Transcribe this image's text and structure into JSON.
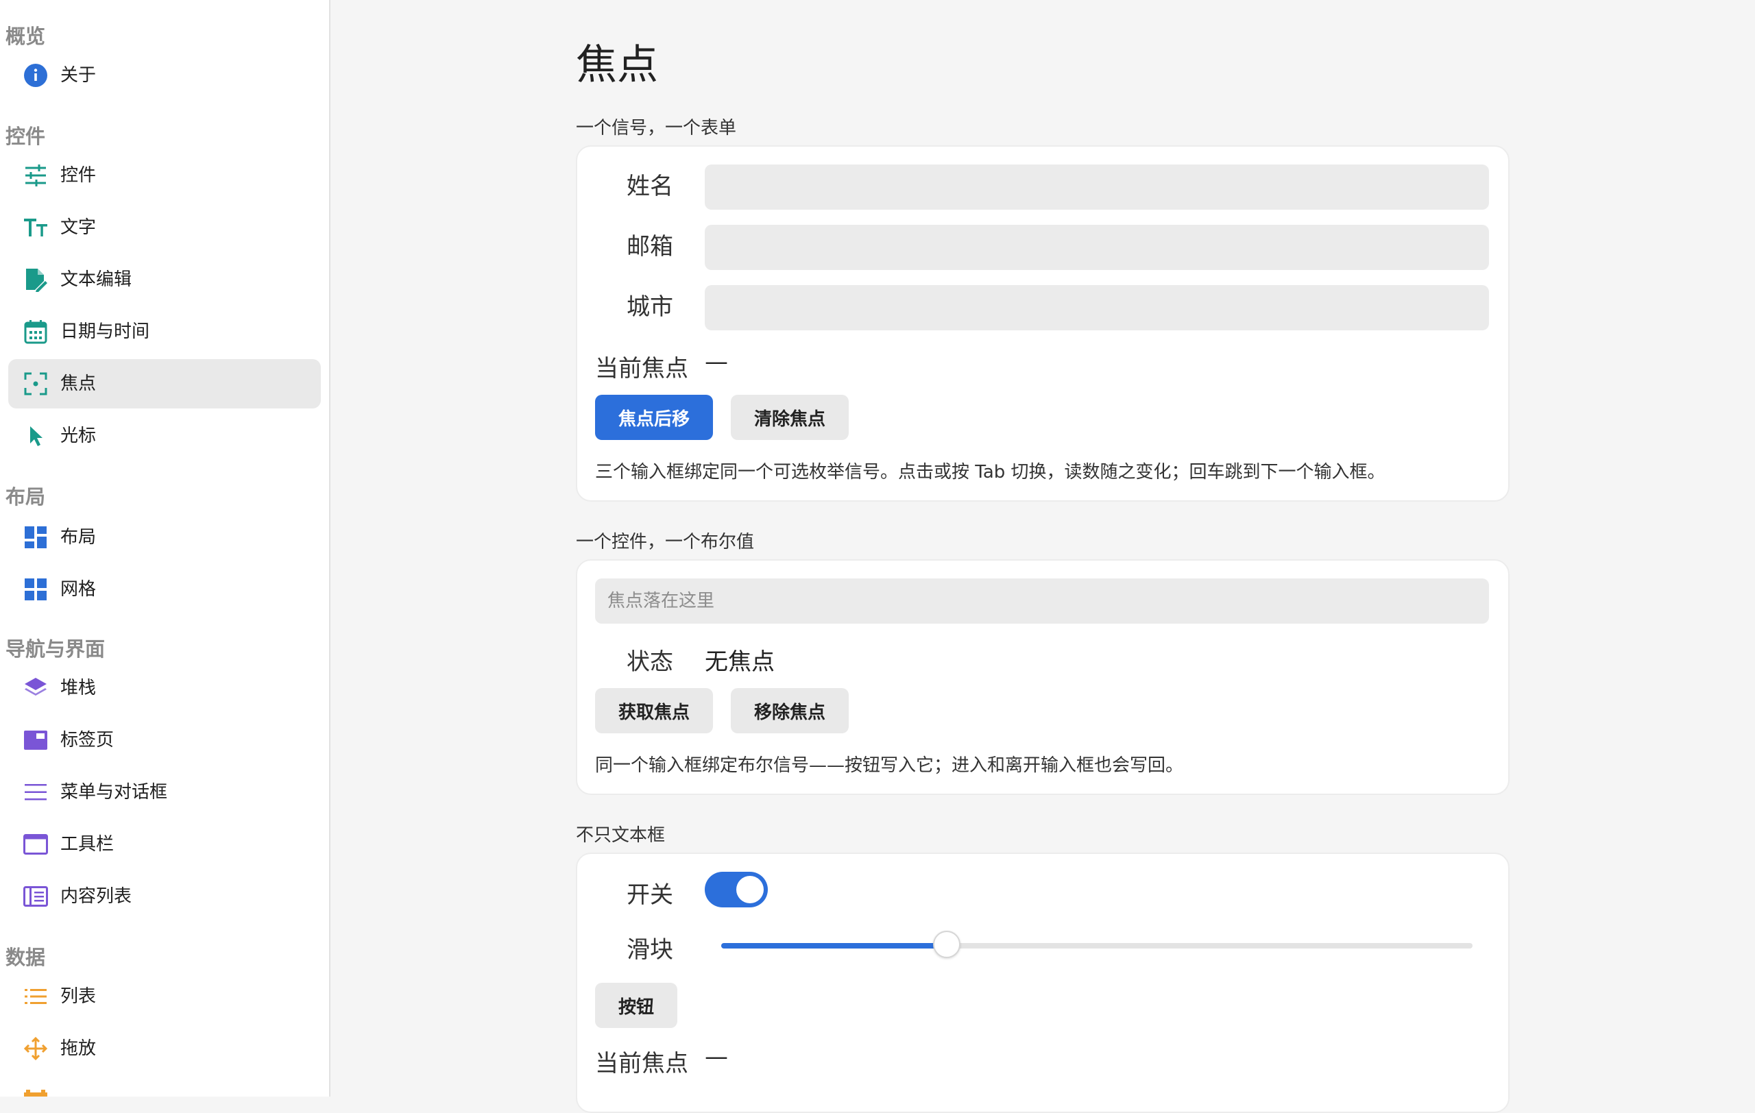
{
  "sidebar": {
    "sections": [
      {
        "title": "概览"
      },
      {
        "title": "控件"
      },
      {
        "title": "布局"
      },
      {
        "title": "导航与界面"
      },
      {
        "title": "数据"
      }
    ],
    "items": [
      {
        "label": "关于",
        "icon": "info-icon"
      },
      {
        "label": "控件",
        "icon": "sliders-icon"
      },
      {
        "label": "文字",
        "icon": "text-size-icon"
      },
      {
        "label": "文本编辑",
        "icon": "file-edit-icon"
      },
      {
        "label": "日期与时间",
        "icon": "calendar-icon"
      },
      {
        "label": "焦点",
        "icon": "focus-icon",
        "active": true
      },
      {
        "label": "光标",
        "icon": "cursor-icon"
      },
      {
        "label": "布局",
        "icon": "layout-icon"
      },
      {
        "label": "网格",
        "icon": "grid-icon"
      },
      {
        "label": "堆栈",
        "icon": "stack-icon"
      },
      {
        "label": "标签页",
        "icon": "tabs-icon"
      },
      {
        "label": "菜单与对话框",
        "icon": "menu-icon"
      },
      {
        "label": "工具栏",
        "icon": "toolbar-icon"
      },
      {
        "label": "内容列表",
        "icon": "content-list-icon"
      },
      {
        "label": "列表",
        "icon": "list-icon"
      },
      {
        "label": "拖放",
        "icon": "move-icon"
      }
    ]
  },
  "colors": {
    "accent": "#2c6fdb",
    "teal": "#1a9a8a",
    "blue_icon": "#2d6fd6",
    "purple_icon": "#7a55d6",
    "orange_icon": "#f0a030"
  },
  "main": {
    "title": "焦点",
    "card1": {
      "caption": "一个信号，一个表单",
      "fields": [
        {
          "label": "姓名",
          "value": ""
        },
        {
          "label": "邮箱",
          "value": ""
        },
        {
          "label": "城市",
          "value": ""
        }
      ],
      "current_focus_label": "当前焦点",
      "current_focus_value": "—",
      "btn_next": "焦点后移",
      "btn_clear": "清除焦点",
      "note": "三个输入框绑定同一个可选枚举信号。点击或按 Tab 切换，读数随之变化；回车跳到下一个输入框。"
    },
    "card2": {
      "caption": "一个控件，一个布尔值",
      "input_placeholder": "焦点落在这里",
      "status_label": "状态",
      "status_value": "无焦点",
      "btn_get": "获取焦点",
      "btn_remove": "移除焦点",
      "note": "同一个输入框绑定布尔信号——按钮写入它；进入和离开输入框也会写回。"
    },
    "card3": {
      "caption": "不只文本框",
      "switch_label": "开关",
      "switch_on": true,
      "slider_label": "滑块",
      "slider_value": 0.3,
      "btn_label": "按钮",
      "current_focus_label": "当前焦点",
      "current_focus_value": "—"
    }
  }
}
